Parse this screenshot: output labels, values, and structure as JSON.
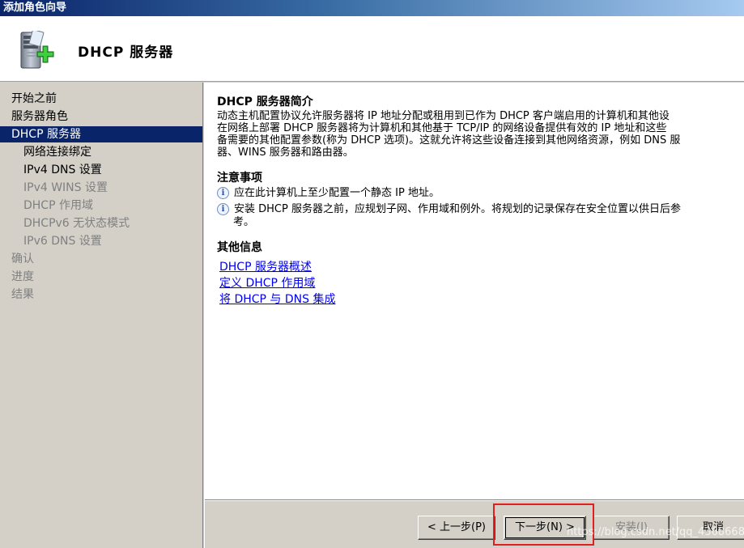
{
  "window": {
    "title": "添加角色向导"
  },
  "header": {
    "title": "DHCP  服务器",
    "icon": "server-add-icon"
  },
  "sidebar": {
    "items": [
      {
        "label": "开始之前",
        "level": 0,
        "state": "normal"
      },
      {
        "label": "服务器角色",
        "level": 0,
        "state": "normal"
      },
      {
        "label": "DHCP 服务器",
        "level": 0,
        "state": "active"
      },
      {
        "label": "网络连接绑定",
        "level": 1,
        "state": "normal"
      },
      {
        "label": "IPv4 DNS 设置",
        "level": 1,
        "state": "normal"
      },
      {
        "label": "IPv4 WINS 设置",
        "level": 1,
        "state": "disabled"
      },
      {
        "label": "DHCP 作用域",
        "level": 1,
        "state": "disabled"
      },
      {
        "label": "DHCPv6 无状态模式",
        "level": 1,
        "state": "disabled"
      },
      {
        "label": "IPv6 DNS 设置",
        "level": 1,
        "state": "disabled"
      },
      {
        "label": "确认",
        "level": 0,
        "state": "disabled"
      },
      {
        "label": "进度",
        "level": 0,
        "state": "disabled"
      },
      {
        "label": "结果",
        "level": 0,
        "state": "disabled"
      }
    ]
  },
  "content": {
    "intro_title": "DHCP  服务器简介",
    "intro_lines": [
      "动态主机配置协议允许服务器将 IP 地址分配或租用到已作为 DHCP 客户端启用的计算机和其他设",
      "在网络上部署 DHCP 服务器将为计算机和其他基于 TCP/IP 的网络设备提供有效的 IP 地址和这些",
      "备需要的其他配置参数(称为 DHCP 选项)。这就允许将这些设备连接到其他网络资源，例如 DNS 服",
      "器、WINS 服务器和路由器。"
    ],
    "notes_title": "注意事项",
    "notes": [
      "应在此计算机上至少配置一个静态 IP 地址。",
      "安装 DHCP 服务器之前，应规划子网、作用域和例外。将规划的记录保存在安全位置以供日后参",
      "考。"
    ],
    "more_title": "其他信息",
    "links": [
      "DHCP 服务器概述",
      "定义 DHCP 作用域",
      "将 DHCP 与 DNS 集成"
    ]
  },
  "footer": {
    "prev_label": "< 上一步(P)",
    "next_label": "下一步(N) >",
    "install_label": "安装(I)",
    "cancel_label": "取消"
  },
  "watermark": "https://blog.csdn.net/qq_43686681",
  "colors": {
    "highlight": "#e02020",
    "active_nav": "#0a246a",
    "link": "#0000ee"
  }
}
